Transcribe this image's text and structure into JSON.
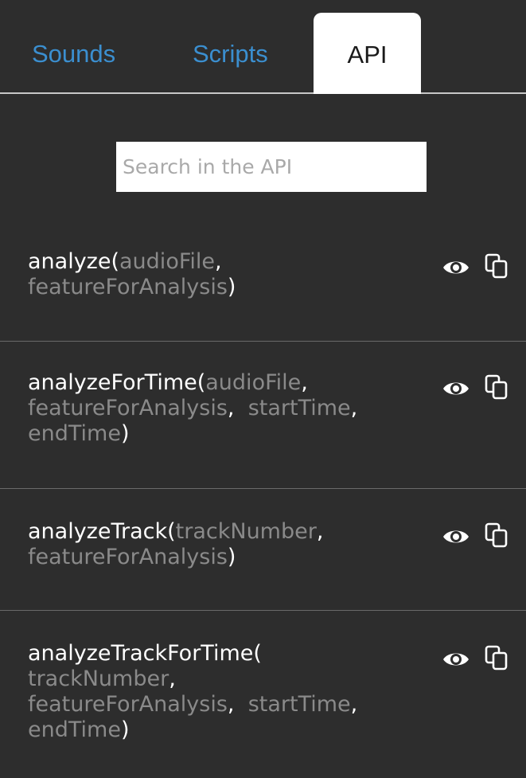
{
  "tabs": {
    "sounds": "Sounds",
    "scripts": "Scripts",
    "api": "API"
  },
  "search": {
    "placeholder": "Search in the API",
    "value": ""
  },
  "entries": [
    {
      "name": "analyze(",
      "params": [
        "audioFile",
        "featureForAnalysis"
      ],
      "close": ")"
    },
    {
      "name": "analyzeForTime(",
      "params": [
        "audioFile",
        "featureForAnalysis",
        "startTime",
        "endTime"
      ],
      "close": ")"
    },
    {
      "name": "analyzeTrack(",
      "params": [
        "trackNumber",
        "featureForAnalysis"
      ],
      "close": ")"
    },
    {
      "name": "analyzeTrackForTime(",
      "params": [
        "trackNumber",
        "featureForAnalysis",
        "startTime",
        "endTime"
      ],
      "close": ")"
    }
  ],
  "separator": ",",
  "icons": {
    "view": "eye-icon",
    "copy": "copy-icon"
  }
}
